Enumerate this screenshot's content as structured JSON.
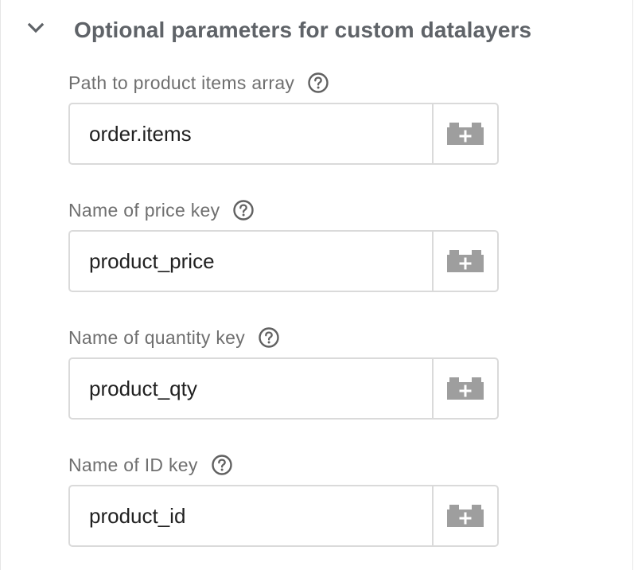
{
  "section": {
    "title": "Optional parameters for custom datalayers",
    "expanded": true
  },
  "fields": [
    {
      "label": "Path to product items array",
      "value": "order.items",
      "help_icon": "help-circle-icon",
      "variable_icon": "variable-brick-plus-icon"
    },
    {
      "label": "Name of price key",
      "value": "product_price",
      "help_icon": "help-circle-icon",
      "variable_icon": "variable-brick-plus-icon"
    },
    {
      "label": "Name of quantity key",
      "value": "product_qty",
      "help_icon": "help-circle-icon",
      "variable_icon": "variable-brick-plus-icon"
    },
    {
      "label": "Name of ID key",
      "value": "product_id",
      "help_icon": "help-circle-icon",
      "variable_icon": "variable-brick-plus-icon"
    }
  ],
  "colors": {
    "title_text": "#5f6368",
    "label_text": "#6f6f6f",
    "input_text": "#212121",
    "border": "#dadada",
    "icon_gray": "#9e9e9e",
    "help_icon": "#616161"
  }
}
